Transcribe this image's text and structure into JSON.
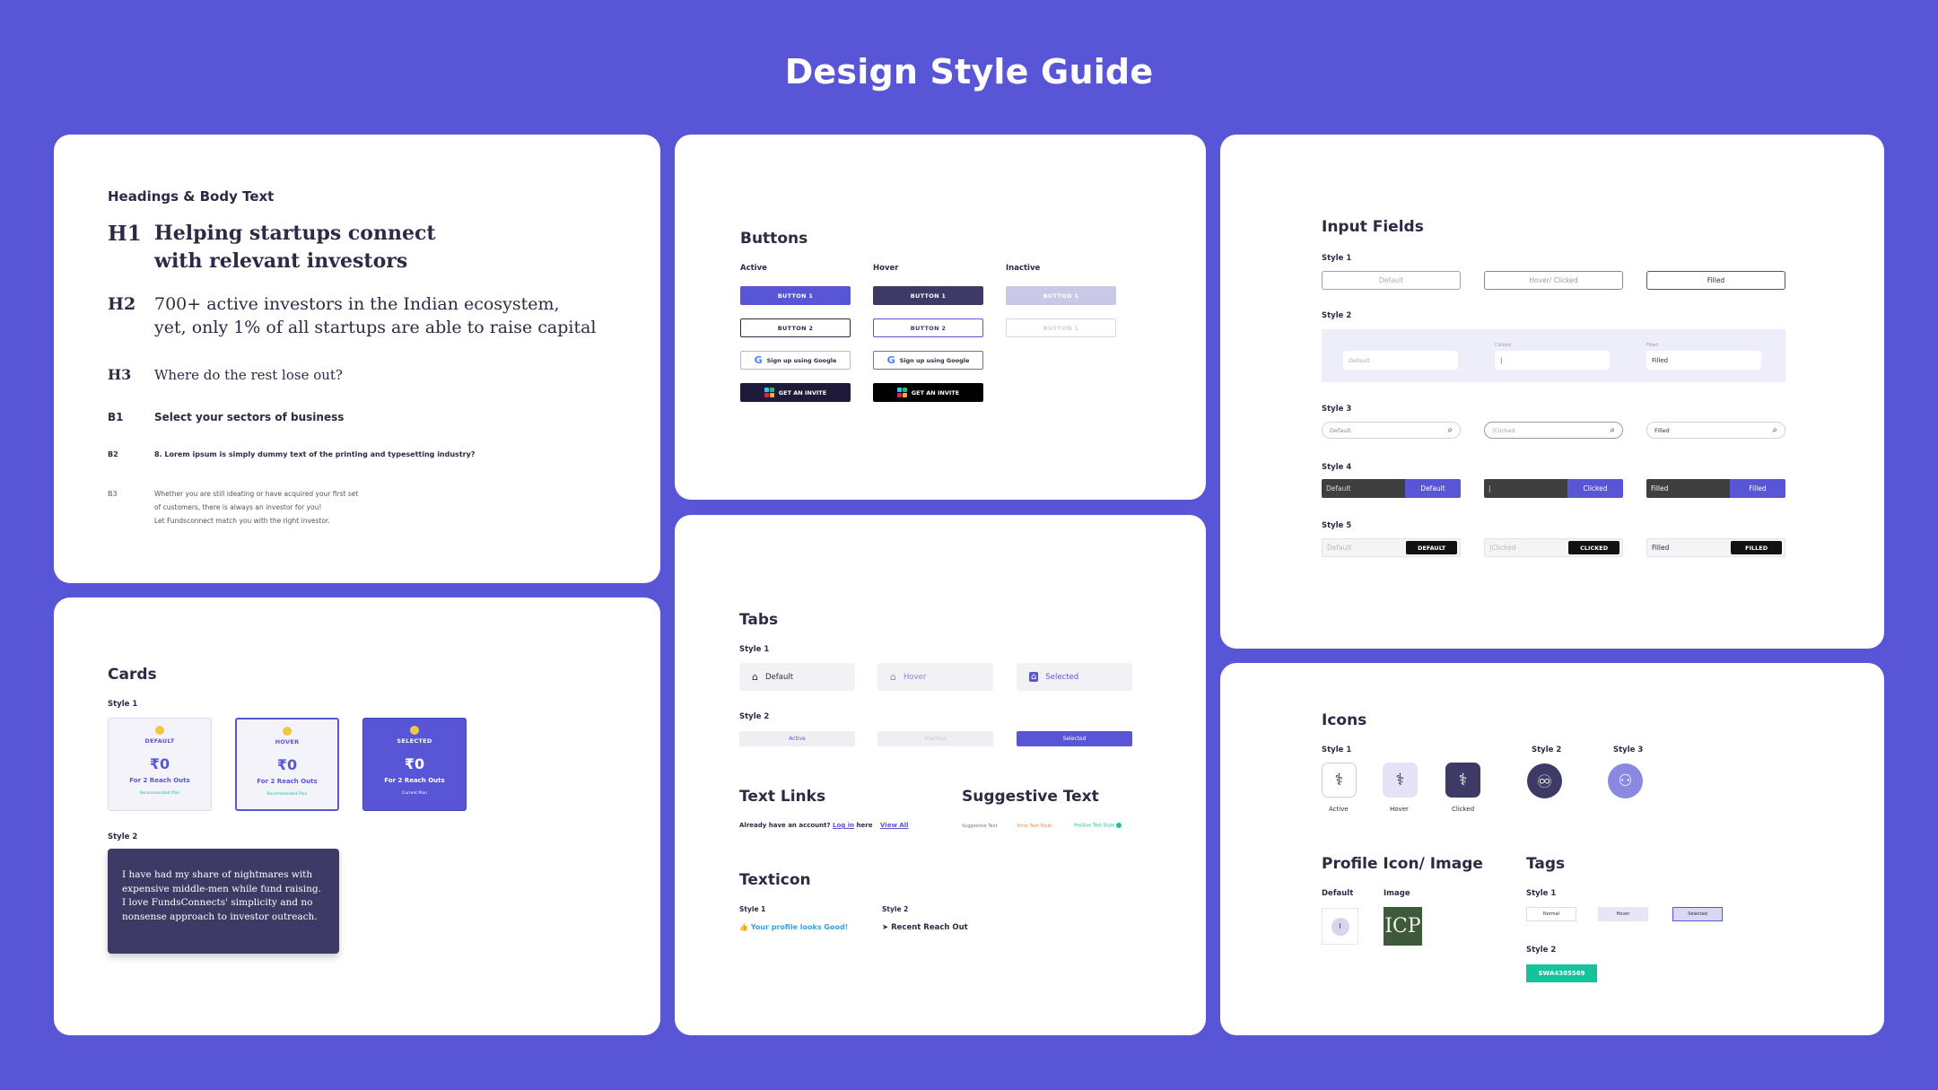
{
  "page": {
    "title": "Design Style Guide"
  },
  "typography": {
    "title": "Headings & Body Text",
    "h1": {
      "tag": "H1",
      "lines": [
        "Helping startups connect",
        "with relevant investors"
      ]
    },
    "h2": {
      "tag": "H2",
      "lines": [
        "700+ active investors in the Indian ecosystem,",
        "yet, only 1% of all startups are able to raise capital"
      ]
    },
    "h3": {
      "tag": "H3",
      "text": "Where do the rest lose out?"
    },
    "b1": {
      "tag": "B1",
      "text": "Select your sectors of business"
    },
    "b2": {
      "tag": "B2",
      "text": "8. Lorem ipsum is simply dummy text of the printing and typesetting industry?"
    },
    "b3": {
      "tag": "B3",
      "lines": [
        "Whether you are still ideating or have acquired your first set",
        "of customers, there is always an investor for you!",
        "Let Fundsconnect match you with the right investor."
      ]
    }
  },
  "buttons": {
    "title": "Buttons",
    "columns": [
      "Active",
      "Hover",
      "Inactive"
    ],
    "button1": "BUTTON 1",
    "button2": "BUTTON 2",
    "google": "Sign up using Google",
    "invite": "GET AN INVITE",
    "colors": {
      "primary": "#5856D6",
      "hover": "#3d3b66",
      "inactive": "#c9c8e6"
    }
  },
  "inputs": {
    "title": "Input Fields",
    "styles": [
      "Style 1",
      "Style 2",
      "Style 3",
      "Style 4",
      "Style 5"
    ],
    "s1": [
      "Default",
      "Hover/ Clicked",
      "Filled"
    ],
    "s2_labels": [
      "Clicked",
      "Filled"
    ],
    "s2": [
      "Default",
      "|",
      "Filled"
    ],
    "s3": [
      "Default",
      "|Clicked",
      "Filled"
    ],
    "s4": [
      {
        "left": "Default",
        "right": "Default"
      },
      {
        "left": "|",
        "right": "Clicked"
      },
      {
        "left": "Filled",
        "right": "Filled"
      }
    ],
    "s5": [
      {
        "left": "Default",
        "right": "DEFAULT"
      },
      {
        "left": "|Clicked",
        "right": "CLICKED"
      },
      {
        "left": "Filled",
        "right": "FILLED"
      }
    ]
  },
  "cards": {
    "title": "Cards",
    "style1": "Style 1",
    "style2": "Style 2",
    "items": [
      {
        "state": "DEFAULT",
        "amount": "₹0",
        "reach": "For 2 Reach Outs",
        "footer": "Recommended Plan"
      },
      {
        "state": "HOVER",
        "amount": "₹0",
        "reach": "For 2 Reach Outs",
        "footer": "Recommended Plan"
      },
      {
        "state": "SELECTED",
        "amount": "₹0",
        "reach": "For 2 Reach Outs",
        "footer": "Current Plan"
      }
    ],
    "quote": "I have had my share of nightmares with expensive middle-men while fund raising. I love FundsConnects' simplicity and no nonsense approach to investor outreach."
  },
  "tabs": {
    "title": "Tabs",
    "style1": "Style 1",
    "style2": "Style 2",
    "s1": [
      "Default",
      "Hover",
      "Selected"
    ],
    "s2": [
      "Active",
      "Inactive",
      "Selected"
    ]
  },
  "text_links": {
    "title": "Text Links",
    "prefix": "Already have an account?",
    "login": "Log in",
    "suffix": "here",
    "view_all": "View All"
  },
  "suggestive": {
    "title": "Suggestive Text",
    "items": [
      "Suggestive Text",
      "Error Text Style",
      "Positive Text Style"
    ]
  },
  "texticon": {
    "title": "Texticon",
    "style1": "Style 1",
    "style2": "Style 2",
    "t1": "Your profile looks Good!",
    "t2": "Recent Reach Out"
  },
  "icons": {
    "title": "Icons",
    "style1": "Style 1",
    "style2": "Style 2",
    "style3": "Style 3",
    "states": [
      "Active",
      "Hover",
      "Clicked"
    ]
  },
  "profile": {
    "title": "Profile Icon/ Image",
    "default": "Default",
    "image": "Image",
    "initial": "I",
    "logo": "ICP"
  },
  "tags": {
    "title": "Tags",
    "style1": "Style 1",
    "style2": "Style 2",
    "s1": [
      "Normal",
      "Hover",
      "Selected"
    ],
    "code": "SWA4385569"
  }
}
